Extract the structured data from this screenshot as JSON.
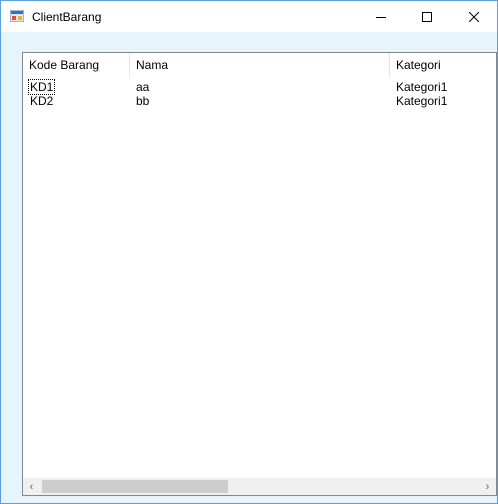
{
  "window": {
    "title": "ClientBarang",
    "icon": "winforms-app-icon"
  },
  "controls": {
    "minimize_icon": "minimize-icon",
    "maximize_icon": "maximize-icon",
    "close_icon": "close-icon"
  },
  "listview": {
    "columns": [
      "Kode Barang",
      "Nama",
      "Kategori"
    ],
    "rows": [
      [
        "KD1",
        "aa",
        "Kategori1"
      ],
      [
        "KD2",
        "bb",
        "Kategori1"
      ]
    ]
  },
  "scrollbar": {
    "left_arrow": "‹",
    "right_arrow": "›"
  }
}
